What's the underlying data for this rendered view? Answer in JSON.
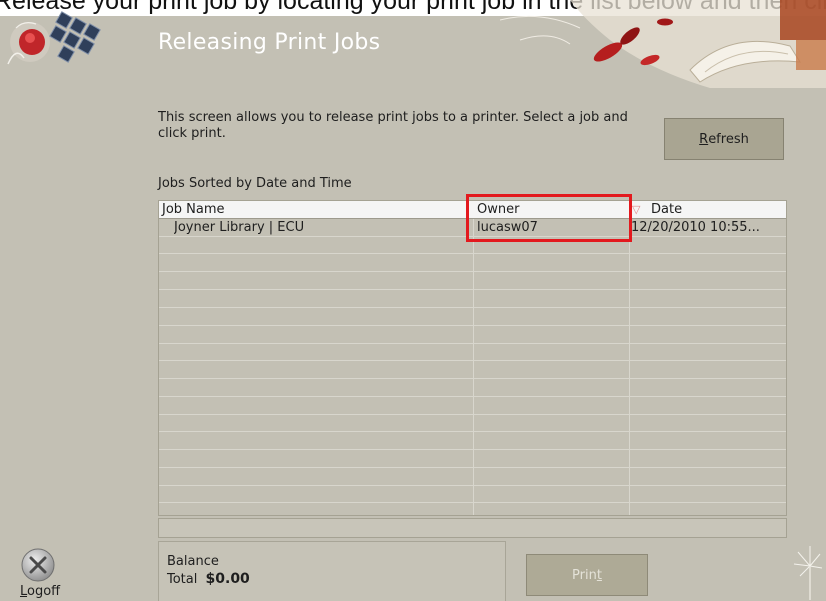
{
  "top_caption": "Release your print job by locating your print job in the list below and then clicking",
  "header": {
    "title": "Releasing Print Jobs"
  },
  "description": "This screen allows you to release print jobs to a printer. Select a job and click print.",
  "refresh_button": {
    "prefix": "",
    "accel": "R",
    "rest": "efresh"
  },
  "jobs_label": "Jobs Sorted by Date and Time",
  "table": {
    "columns": [
      {
        "label": "Job Name"
      },
      {
        "label": "Owner"
      },
      {
        "label": "Date",
        "sort_indicator": "▽"
      }
    ],
    "rows": [
      {
        "job_name": "Joyner Library | ECU",
        "owner": "lucasw07",
        "date": "12/20/2010 10:55..."
      }
    ]
  },
  "balance": {
    "label": "Balance",
    "total_label": "Total",
    "amount": "$0.00"
  },
  "print_button": {
    "prefix": "Prin",
    "accel": "t",
    "rest": ""
  },
  "logoff": {
    "accel": "L",
    "rest": "ogoff"
  },
  "colors": {
    "background": "#c3c0b4",
    "button": "#a9a592",
    "highlight": "#e3191e",
    "title": "#ffffff"
  }
}
